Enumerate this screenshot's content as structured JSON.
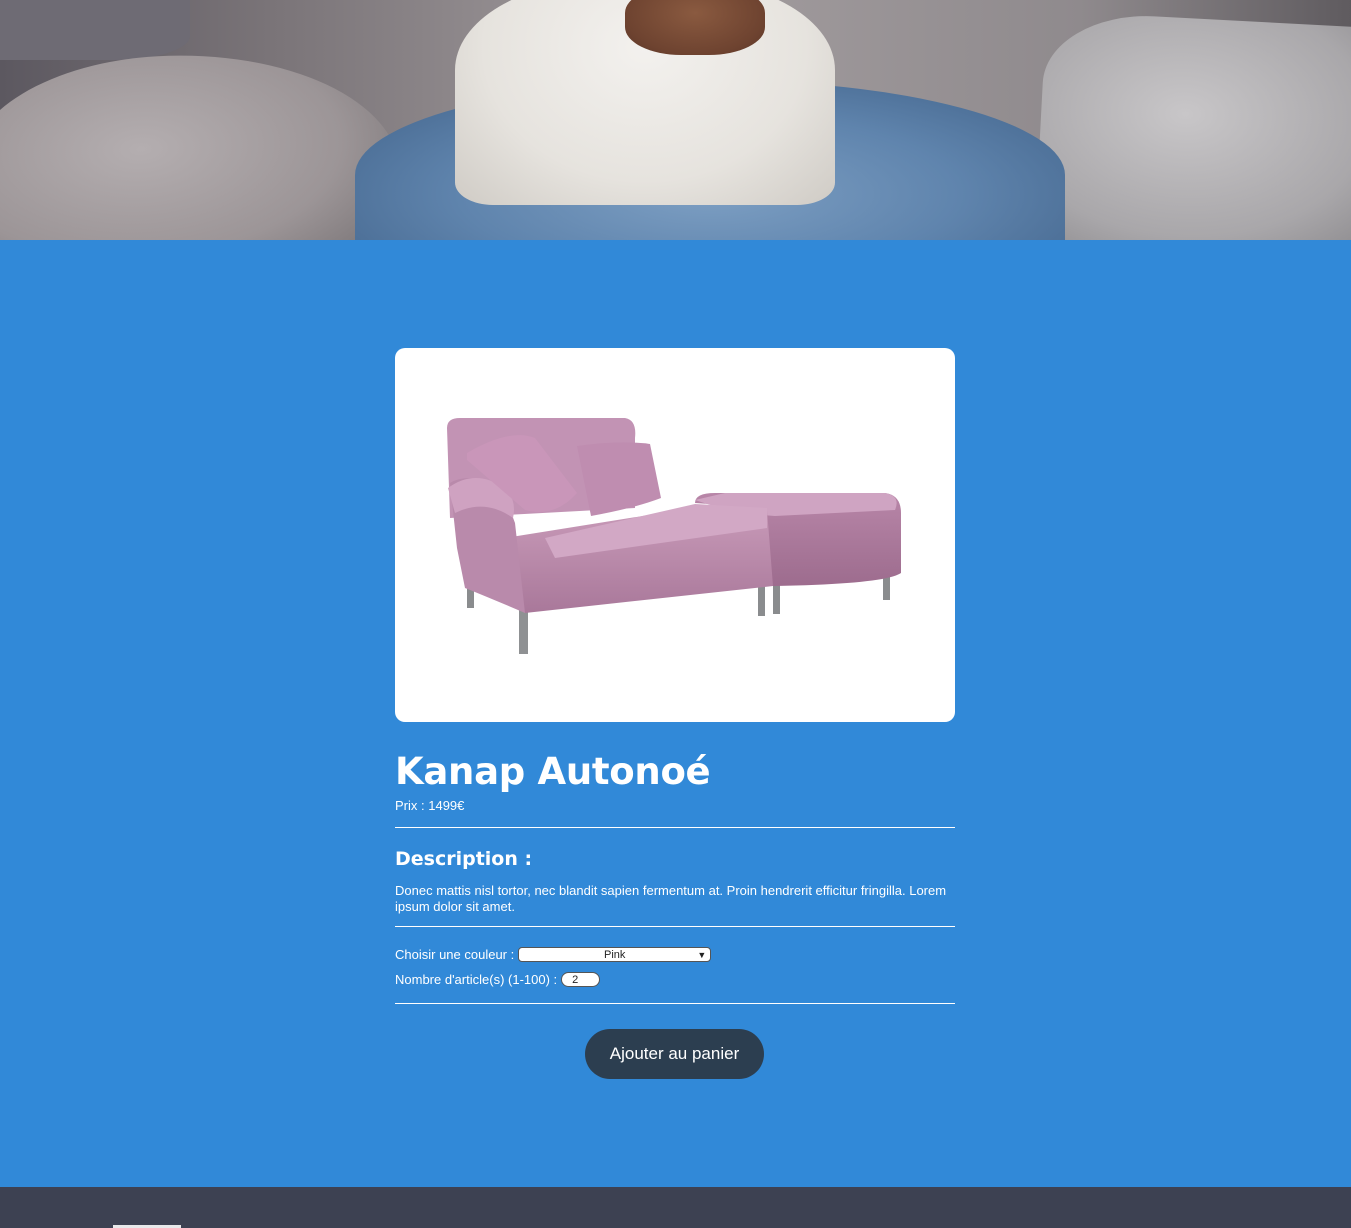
{
  "product": {
    "title": "Kanap Autonoé",
    "price_label": "Prix : ",
    "price_value": "1499",
    "currency": "€",
    "image_alt": "Photo d'un canapé"
  },
  "description": {
    "heading": "Description :",
    "text": "Donec mattis nisl tortor, nec blandit sapien fermentum at. Proin hendrerit efficitur fringilla. Lorem ipsum dolor sit amet."
  },
  "options": {
    "color_label": "Choisir une couleur :",
    "color_selected": "Pink",
    "quantity_label": "Nombre d'article(s) (1-100) :",
    "quantity_value": "2"
  },
  "actions": {
    "add_to_cart": "Ajouter au panier"
  },
  "colors": {
    "main_bg": "#3189d8",
    "footer_bg": "#3d4152",
    "button_bg": "#2c3e50"
  }
}
